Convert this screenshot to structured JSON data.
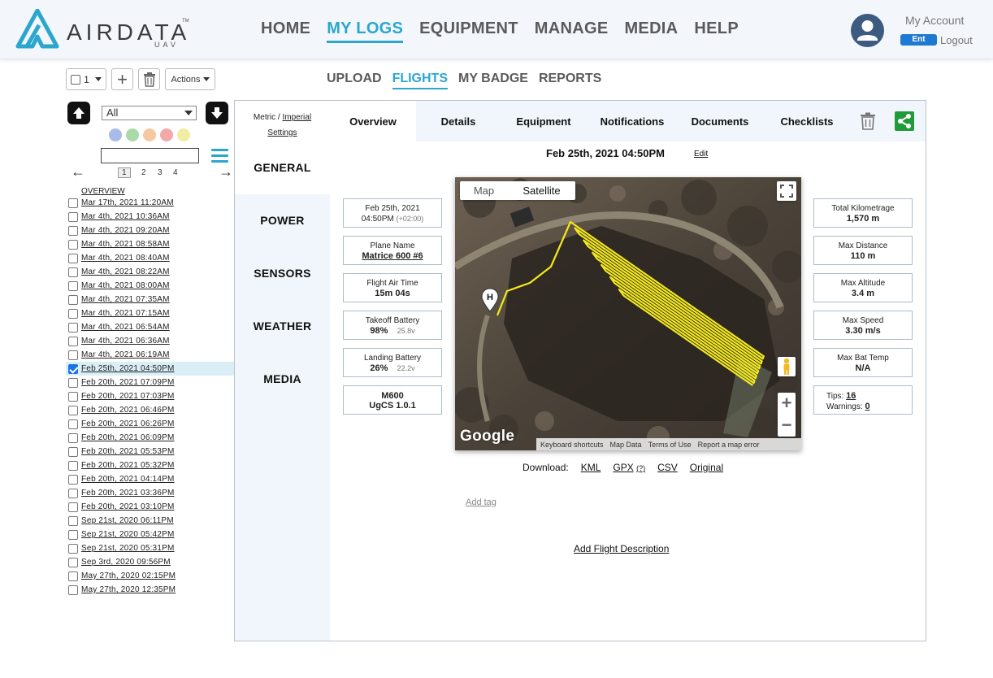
{
  "brand": {
    "name": "AIRDATA",
    "sub": "UAV",
    "tm": "TM"
  },
  "nav": {
    "items": [
      "HOME",
      "MY LOGS",
      "EQUIPMENT",
      "MANAGE",
      "MEDIA",
      "HELP"
    ],
    "active": "MY LOGS"
  },
  "account": {
    "label": "My Account",
    "badge": "Ent",
    "logout": "Logout"
  },
  "toolbar": {
    "select_value": "1",
    "actions_label": "Actions",
    "add_label": "+"
  },
  "subnav": {
    "items": [
      "UPLOAD",
      "FLIGHTS",
      "MY BADGE",
      "REPORTS"
    ],
    "active": "FLIGHTS"
  },
  "sidebar": {
    "filter_value": "All",
    "color_dots": [
      "#a9bbe8",
      "#a8dba8",
      "#f5c9a0",
      "#f3a9a9",
      "#f1eea3"
    ],
    "pages": [
      "1",
      "2",
      "3",
      "4"
    ],
    "current_page": "1",
    "prev_arrow": "←",
    "next_arrow": "→",
    "overview_label": "OVERVIEW",
    "flights": [
      {
        "label": "Mar 17th, 2021 11:20AM",
        "checked": false
      },
      {
        "label": "Mar 4th, 2021 10:36AM",
        "checked": false
      },
      {
        "label": "Mar 4th, 2021 09:20AM",
        "checked": false
      },
      {
        "label": "Mar 4th, 2021 08:58AM",
        "checked": false
      },
      {
        "label": "Mar 4th, 2021 08:40AM",
        "checked": false
      },
      {
        "label": "Mar 4th, 2021 08:22AM",
        "checked": false
      },
      {
        "label": "Mar 4th, 2021 08:00AM",
        "checked": false
      },
      {
        "label": "Mar 4th, 2021 07:35AM",
        "checked": false
      },
      {
        "label": "Mar 4th, 2021 07:15AM",
        "checked": false
      },
      {
        "label": "Mar 4th, 2021 06:54AM",
        "checked": false
      },
      {
        "label": "Mar 4th, 2021 06:36AM",
        "checked": false
      },
      {
        "label": "Mar 4th, 2021 06:19AM",
        "checked": false
      },
      {
        "label": "Feb 25th, 2021 04:50PM",
        "checked": true
      },
      {
        "label": "Feb 20th, 2021 07:09PM",
        "checked": false
      },
      {
        "label": "Feb 20th, 2021 07:03PM",
        "checked": false
      },
      {
        "label": "Feb 20th, 2021 06:46PM",
        "checked": false
      },
      {
        "label": "Feb 20th, 2021 06:26PM",
        "checked": false
      },
      {
        "label": "Feb 20th, 2021 06:09PM",
        "checked": false
      },
      {
        "label": "Feb 20th, 2021 05:53PM",
        "checked": false
      },
      {
        "label": "Feb 20th, 2021 05:32PM",
        "checked": false
      },
      {
        "label": "Feb 20th, 2021 04:14PM",
        "checked": false
      },
      {
        "label": "Feb 20th, 2021 03:36PM",
        "checked": false
      },
      {
        "label": "Feb 20th, 2021 03:10PM",
        "checked": false
      },
      {
        "label": "Sep 21st, 2020 06:11PM",
        "checked": false
      },
      {
        "label": "Sep 21st, 2020 05:42PM",
        "checked": false
      },
      {
        "label": "Sep 21st, 2020 05:31PM",
        "checked": false
      },
      {
        "label": "Sep 3rd, 2020 09:56PM",
        "checked": false
      },
      {
        "label": "May 27th, 2020 02:15PM",
        "checked": false
      },
      {
        "label": "May 27th, 2020 12:35PM",
        "checked": false
      }
    ]
  },
  "panel": {
    "units": {
      "metric": "Metric",
      "separator": " / ",
      "imperial": "Imperial",
      "settings": "Settings"
    },
    "side_tabs": [
      "GENERAL",
      "POWER",
      "SENSORS",
      "WEATHER",
      "MEDIA"
    ],
    "active_side_tab": "GENERAL",
    "top_tabs": [
      "Overview",
      "Details",
      "Equipment",
      "Notifications",
      "Documents",
      "Checklists"
    ],
    "active_top_tab": "Overview",
    "flight_title": "Feb 25th, 2021 04:50PM",
    "edit_label": "Edit",
    "left_stats": {
      "date": {
        "line1": "Feb 25th, 2021",
        "line2": "04:50PM",
        "tz": "(+02:00)"
      },
      "plane": {
        "label": "Plane Name",
        "value": "Matrice 600 #6"
      },
      "air_time": {
        "label": "Flight Air Time",
        "value": "15m 04s"
      },
      "takeoff": {
        "label": "Takeoff Battery",
        "value": "98%",
        "volt": "25.8v"
      },
      "landing": {
        "label": "Landing Battery",
        "value": "26%",
        "volt": "22.2v"
      },
      "app": {
        "line1": "M600",
        "line2": "UgCS 1.0.1"
      }
    },
    "right_stats": {
      "km": {
        "label": "Total Kilometrage",
        "value": "1,570 m"
      },
      "distance": {
        "label": "Max Distance",
        "value": "110 m"
      },
      "altitude": {
        "label": "Max Altitude",
        "value": "3.4 m"
      },
      "speed": {
        "label": "Max Speed",
        "value": "3.30 m/s"
      },
      "temp": {
        "label": "Max Bat Temp",
        "value": "N/A"
      },
      "tips": {
        "tips_label": "Tips:",
        "tips_value": "16",
        "warn_label": "Warnings:",
        "warn_value": "0"
      }
    },
    "map": {
      "toggle": [
        "Map",
        "Satellite"
      ],
      "active": "Satellite",
      "home_marker": "H",
      "google": "Google",
      "footer": [
        "Keyboard shortcuts",
        "Map Data",
        "Terms of Use",
        "Report a map error"
      ],
      "zoom_in": "+",
      "zoom_out": "−",
      "path_color": "#f3ea1a"
    },
    "download": {
      "label": "Download:",
      "kml": "KML",
      "gpx": "GPX",
      "gpx_help": "(?)",
      "csv": "CSV",
      "original": "Original"
    },
    "add_tag": "Add tag",
    "add_description": "Add Flight Description"
  },
  "colors": {
    "accent": "#2ba7cf",
    "ent_badge": "#1f78d1",
    "share": "#219a3a"
  }
}
